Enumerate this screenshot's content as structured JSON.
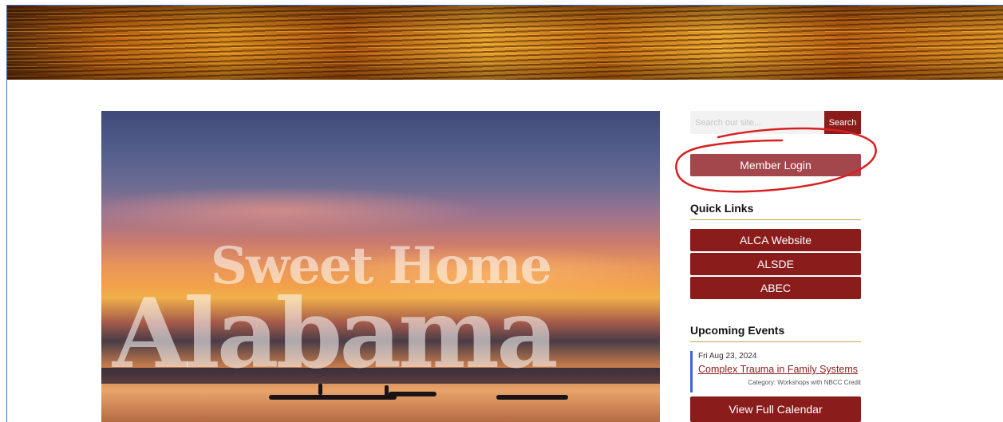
{
  "hero": {
    "line1": "Sweet Home",
    "line2": "Alabama"
  },
  "search": {
    "placeholder": "Search our site...",
    "button_label": "Search"
  },
  "member_login": {
    "label": "Member Login"
  },
  "quick_links": {
    "heading": "Quick Links",
    "items": [
      {
        "label": "ALCA Website"
      },
      {
        "label": "ALSDE"
      },
      {
        "label": "ABEC"
      }
    ]
  },
  "upcoming_events": {
    "heading": "Upcoming Events",
    "events": [
      {
        "date": "Fri Aug 23, 2024",
        "title": "Complex Trauma in Family Systems",
        "category": "Category: Workshops with NBCC Credit"
      }
    ],
    "calendar_button": "View Full Calendar"
  },
  "colors": {
    "primary": "#8b1c1c",
    "login_button": "#a3474c",
    "heading_rule": "#c9a44c",
    "event_accent": "#3a64e0",
    "annotation": "#d81f1f"
  }
}
